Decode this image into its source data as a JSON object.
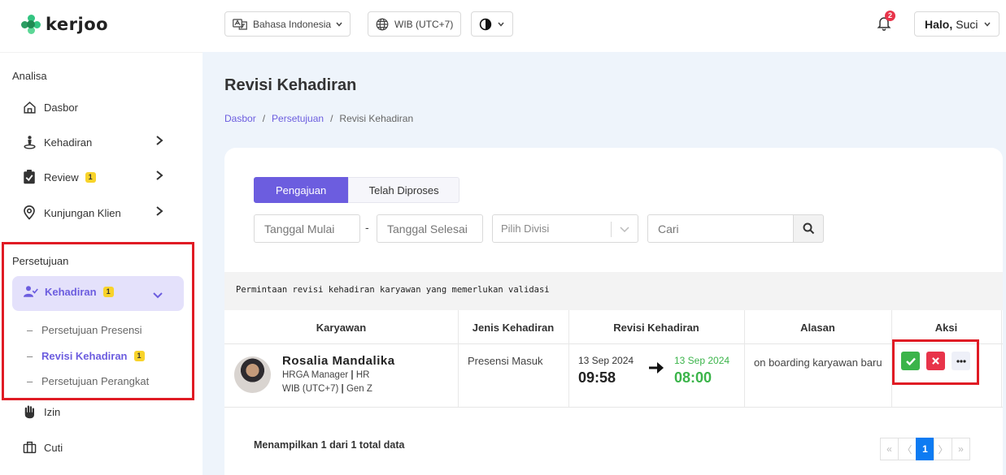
{
  "app": {
    "logo_text": "kerjoo"
  },
  "sidebar": {
    "section_analisa": "Analisa",
    "items_analisa": [
      {
        "label": "Dasbor",
        "icon": "home-icon"
      },
      {
        "label": "Kehadiran",
        "icon": "person-location-icon"
      },
      {
        "label": "Review",
        "icon": "clipboard-check-icon",
        "badge": "1"
      },
      {
        "label": "Kunjungan Klien",
        "icon": "map-pin-icon"
      }
    ],
    "section_persetujuan": "Persetujuan",
    "active_group": {
      "label": "Kehadiran",
      "badge": "1",
      "icon": "user-check-icon"
    },
    "sub_items": [
      {
        "label": "Persetujuan Presensi"
      },
      {
        "label": "Revisi Kehadiran",
        "badge": "1",
        "active": true
      },
      {
        "label": "Persetujuan Perangkat"
      }
    ],
    "items_bottom": [
      {
        "label": "Izin",
        "icon": "hand-icon"
      },
      {
        "label": "Cuti",
        "icon": "briefcase-icon"
      }
    ]
  },
  "topbar": {
    "language": "Bahasa Indonesia",
    "timezone": "WIB (UTC+7)",
    "notification_count": "2",
    "greeting": "Halo,",
    "user_name": "Suci"
  },
  "page": {
    "title": "Revisi Kehadiran",
    "breadcrumb": [
      "Dasbor",
      "Persetujuan",
      "Revisi Kehadiran"
    ],
    "tabs": [
      "Pengajuan",
      "Telah Diproses"
    ],
    "filters": {
      "start_date": "Tanggal Mulai",
      "end_date": "Tanggal Selesai",
      "division": "Pilih Divisi",
      "search": "Cari"
    },
    "info_text": "Permintaan revisi kehadiran karyawan yang memerlukan validasi",
    "table": {
      "headers": [
        "Karyawan",
        "Jenis Kehadiran",
        "Revisi Kehadiran",
        "Alasan",
        "Aksi"
      ],
      "rows": [
        {
          "name": "Rosalia Mandalika",
          "position": "HRGA Manager",
          "division": "HR",
          "timezone": "WIB (UTC+7)",
          "group": "Gen Z",
          "attendance_type": "Presensi Masuk",
          "old_date": "13 Sep 2024",
          "old_time": "09:58",
          "new_date": "13 Sep 2024",
          "new_time": "08:00",
          "reason": "on boarding karyawan baru"
        }
      ]
    },
    "summary": "Menampilkan 1 dari 1 total data",
    "pagination": {
      "first": "«",
      "prev": "〈",
      "current": "1",
      "next": "〉",
      "last": "»"
    }
  },
  "colors": {
    "accent": "#6c5ddf",
    "approve": "#3bb44a",
    "reject": "#e8344a",
    "new_value": "#3bb44a",
    "highlight_box": "#e01b24"
  }
}
